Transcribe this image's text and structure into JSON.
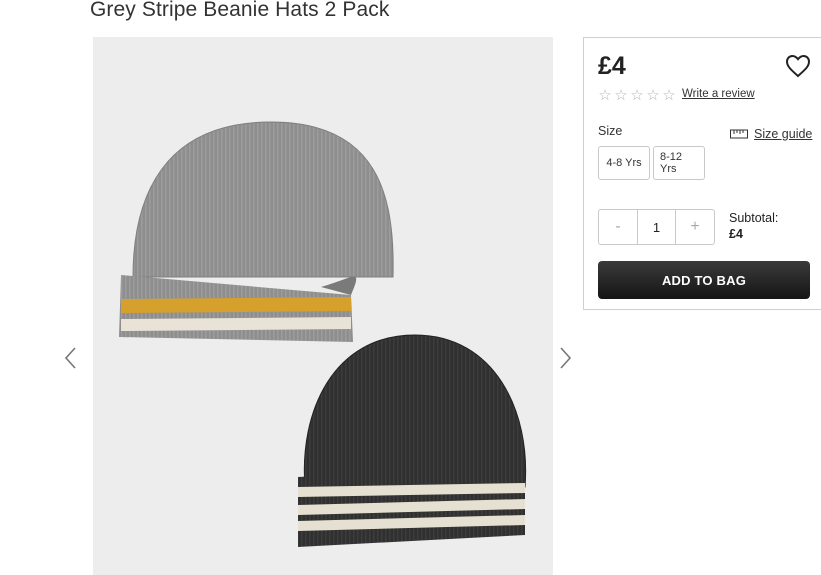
{
  "product": {
    "title": "Grey Stripe Beanie Hats 2 Pack",
    "price": "£4"
  },
  "reviews": {
    "stars": [
      "☆",
      "☆",
      "☆",
      "☆",
      "☆"
    ],
    "write_review_label": "Write a review"
  },
  "size": {
    "label": "Size",
    "guide_label": "Size guide",
    "options": [
      "4-8 Yrs",
      "8-12 Yrs"
    ]
  },
  "quantity": {
    "minus": "-",
    "value": "1",
    "plus": "+"
  },
  "subtotal": {
    "label": "Subtotal:",
    "value": "£4"
  },
  "actions": {
    "add_to_bag": "ADD TO BAG"
  },
  "icons": {
    "prev": "chevron-left-icon",
    "next": "chevron-right-icon",
    "wishlist": "heart-icon",
    "size_guide": "ruler-icon"
  },
  "colors": {
    "grey_hat": "#8f8f8f",
    "mustard_stripe": "#d7a12a",
    "cream_stripe": "#ece7d9",
    "dark_hat": "#2f2f2f",
    "button": "#222222"
  }
}
